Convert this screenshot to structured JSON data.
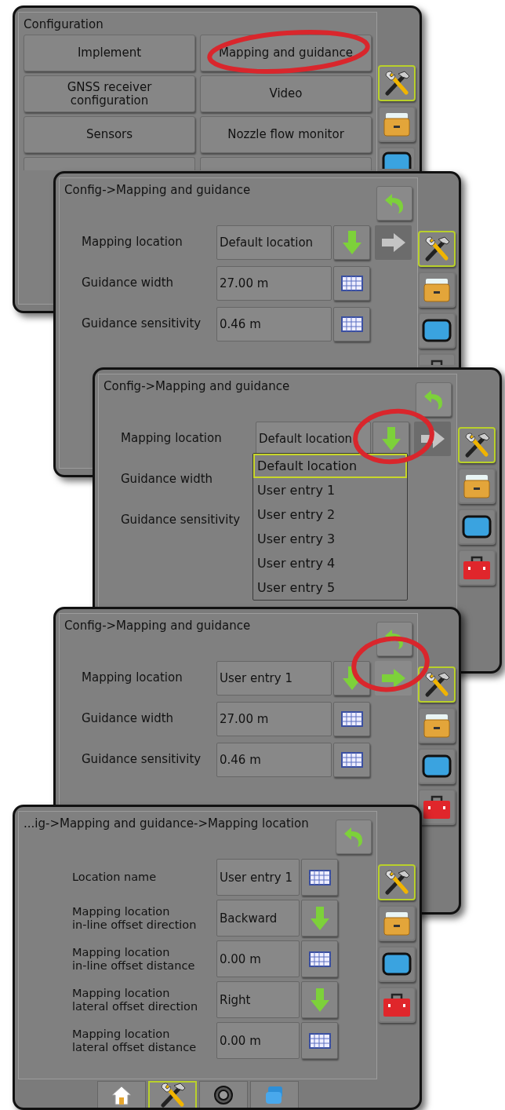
{
  "screens": [
    {
      "kind": "menu",
      "title": "Configuration",
      "buttons": [
        {
          "label": "Implement"
        },
        {
          "label": "Mapping and guidance"
        },
        {
          "label": "GNSS receiver\nconfiguration"
        },
        {
          "label": "Video"
        },
        {
          "label": "Sensors"
        },
        {
          "label": "Nozzle flow monitor"
        }
      ],
      "side_tabs": [
        {
          "kind": "tools",
          "selected": true
        },
        {
          "kind": "drawer",
          "selected": false
        },
        {
          "kind": "display",
          "selected": false
        }
      ]
    },
    {
      "kind": "settings",
      "title": "Config->Mapping and guidance",
      "rows": [
        {
          "label": "Mapping location",
          "value": "Default location",
          "actions": [
            {
              "kind": "down"
            },
            {
              "kind": "next",
              "disabled": true
            }
          ]
        },
        {
          "label": "Guidance width",
          "value": "27.00 m",
          "actions": [
            {
              "kind": "keyboard"
            }
          ]
        },
        {
          "label": "Guidance sensitivity",
          "value": "0.46 m",
          "actions": [
            {
              "kind": "keyboard"
            }
          ]
        }
      ],
      "side_tabs": [
        {
          "kind": "tools",
          "selected": true
        },
        {
          "kind": "drawer",
          "selected": false
        },
        {
          "kind": "display",
          "selected": false
        },
        {
          "kind": "toolbox",
          "selected": false
        }
      ]
    },
    {
      "kind": "settings",
      "title": "Config->Mapping and guidance",
      "rows": [
        {
          "label": "Mapping location",
          "value": "Default location",
          "actions": [
            {
              "kind": "down"
            },
            {
              "kind": "next",
              "disabled": true
            }
          ]
        },
        {
          "label": "Guidance width"
        },
        {
          "label": "Guidance sensitivity"
        }
      ],
      "dropdown": {
        "options": [
          {
            "label": "Default location",
            "selected": true
          },
          {
            "label": "User entry 1",
            "selected": false
          },
          {
            "label": "User entry 2",
            "selected": false
          },
          {
            "label": "User entry 3",
            "selected": false
          },
          {
            "label": "User entry 4",
            "selected": false
          },
          {
            "label": "User entry 5",
            "selected": false
          }
        ]
      },
      "side_tabs": [
        {
          "kind": "tools",
          "selected": true
        },
        {
          "kind": "drawer",
          "selected": false
        },
        {
          "kind": "display",
          "selected": false
        },
        {
          "kind": "toolbox",
          "selected": false
        }
      ]
    },
    {
      "kind": "settings",
      "title": "Config->Mapping and guidance",
      "rows": [
        {
          "label": "Mapping location",
          "value": "User entry 1",
          "actions": [
            {
              "kind": "down"
            },
            {
              "kind": "next",
              "disabled": false
            }
          ]
        },
        {
          "label": "Guidance width",
          "value": "27.00 m",
          "actions": [
            {
              "kind": "keyboard"
            }
          ]
        },
        {
          "label": "Guidance sensitivity",
          "value": "0.46 m",
          "actions": [
            {
              "kind": "keyboard"
            }
          ]
        }
      ],
      "side_tabs": [
        {
          "kind": "tools",
          "selected": true
        },
        {
          "kind": "drawer",
          "selected": false
        },
        {
          "kind": "display",
          "selected": false
        },
        {
          "kind": "toolbox",
          "selected": false
        }
      ]
    },
    {
      "kind": "detail",
      "title": "...ig->Mapping and guidance->Mapping location",
      "rows": [
        {
          "label": "Location name",
          "value": "User entry 1",
          "actions": [
            {
              "kind": "keyboard"
            }
          ]
        },
        {
          "label": "Mapping location\nin-line offset direction",
          "value": "Backward",
          "actions": [
            {
              "kind": "down"
            }
          ]
        },
        {
          "label": "Mapping location\nin-line offset distance",
          "value": "0.00 m",
          "actions": [
            {
              "kind": "keyboard"
            }
          ]
        },
        {
          "label": "Mapping location\nlateral offset direction",
          "value": "Right",
          "actions": [
            {
              "kind": "down"
            }
          ]
        },
        {
          "label": "Mapping location\nlateral offset distance",
          "value": "0.00 m",
          "actions": [
            {
              "kind": "keyboard"
            }
          ]
        }
      ],
      "side_tabs": [
        {
          "kind": "tools",
          "selected": true
        },
        {
          "kind": "drawer",
          "selected": false
        },
        {
          "kind": "display",
          "selected": false
        },
        {
          "kind": "toolbox",
          "selected": false
        }
      ],
      "bottom_tabs": [
        {
          "kind": "home",
          "selected": false
        },
        {
          "kind": "tools",
          "selected": true
        },
        {
          "kind": "camera",
          "selected": false
        },
        {
          "kind": "files",
          "selected": false
        }
      ]
    }
  ]
}
